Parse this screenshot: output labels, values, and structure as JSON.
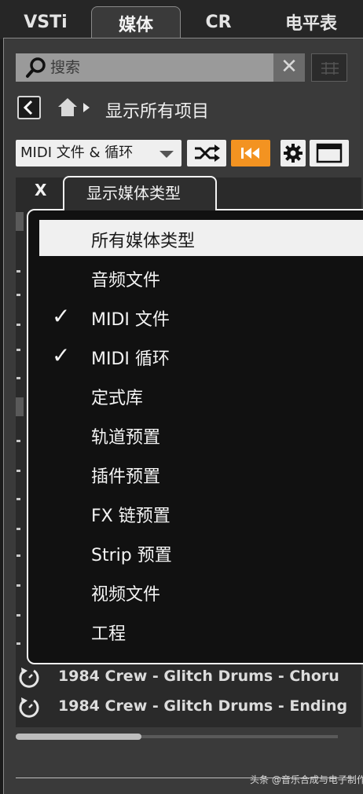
{
  "tabs": [
    {
      "label": "VSTi",
      "active": false
    },
    {
      "label": "媒体",
      "active": true
    },
    {
      "label": "CR",
      "active": false
    },
    {
      "label": "电平表",
      "active": false
    }
  ],
  "search": {
    "placeholder": "搜索",
    "value": "",
    "clear_label": "✕"
  },
  "breadcrumb": {
    "label": "显示所有项目"
  },
  "filter": {
    "selected": "MIDI 文件 & 循环"
  },
  "popup": {
    "close_label": "X",
    "title": "显示媒体类型",
    "items": [
      {
        "label": "所有媒体类型",
        "checked": false,
        "selected": true
      },
      {
        "label": "音频文件",
        "checked": false,
        "selected": false
      },
      {
        "label": "MIDI 文件",
        "checked": true,
        "selected": false
      },
      {
        "label": "MIDI 循环",
        "checked": true,
        "selected": false
      },
      {
        "label": "定式库",
        "checked": false,
        "selected": false
      },
      {
        "label": "轨道预置",
        "checked": false,
        "selected": false
      },
      {
        "label": "插件预置",
        "checked": false,
        "selected": false
      },
      {
        "label": "FX 链预置",
        "checked": false,
        "selected": false
      },
      {
        "label": "Strip 预置",
        "checked": false,
        "selected": false
      },
      {
        "label": "视频文件",
        "checked": false,
        "selected": false
      },
      {
        "label": "工程",
        "checked": false,
        "selected": false
      }
    ],
    "check_glyph": "✓"
  },
  "files": [
    {
      "name": "1984 Crew - Glitch Drums - Choru",
      "icon": "loop-icon"
    },
    {
      "name": "1984 Crew - Glitch Drums - Ending",
      "icon": "loop-icon"
    }
  ],
  "watermark": "头条 @音乐合成与电子制作",
  "colors": {
    "accent": "#f39321",
    "panel": "#3a3a3a",
    "popup_bg": "#111111"
  }
}
